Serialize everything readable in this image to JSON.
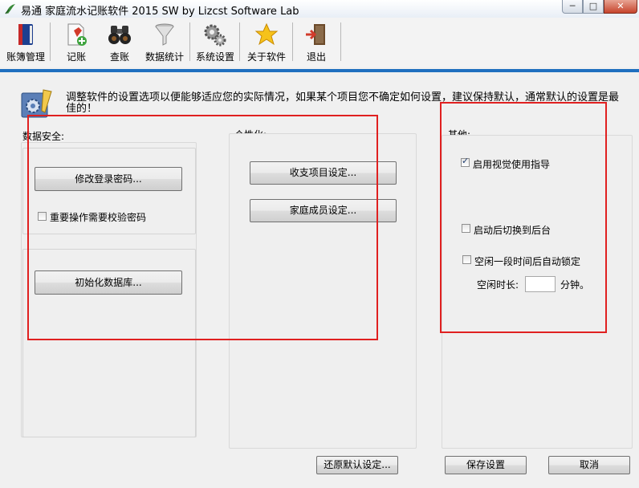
{
  "window": {
    "title": "易通 家庭流水记账软件 2015  SW   by Lizcst Software Lab",
    "controls": {
      "minimize": "─",
      "maximize": "□",
      "close": "✕"
    }
  },
  "toolbar": {
    "items": [
      {
        "label": "账簿管理",
        "icon": "ledger-book-icon"
      },
      {
        "label": "记账",
        "icon": "document-add-icon"
      },
      {
        "label": "查账",
        "icon": "binoculars-icon"
      },
      {
        "label": "数据统计",
        "icon": "funnel-icon"
      },
      {
        "label": "系统设置",
        "icon": "gears-icon"
      },
      {
        "label": "关于软件",
        "icon": "star-icon"
      },
      {
        "label": "退出",
        "icon": "exit-door-icon"
      }
    ]
  },
  "info": {
    "text": "调整软件的设置选项以便能够适应您的实际情况，如果某个项目您不确定如何设置，建议保持默认，通常默认的设置是最佳的！"
  },
  "security": {
    "title": "数据安全:",
    "change_password": "修改登录密码...",
    "verify_password_label": "重要操作需要校验密码",
    "verify_password_checked": false,
    "init_database": "初始化数据库..."
  },
  "personal": {
    "title": "个性化:",
    "income_expense_items": "收支项目设定...",
    "family_members": "家庭成员设定..."
  },
  "other": {
    "title": "其他:",
    "visual_guide_label": "启用视觉使用指导",
    "visual_guide_checked": true,
    "switch_background_label": "启动后切换到后台",
    "switch_background_checked": false,
    "auto_lock_label": "空闲一段时间后自动锁定",
    "auto_lock_checked": false,
    "idle_time_label": "空闲时长:",
    "idle_time_value": "",
    "idle_time_unit": "分钟。"
  },
  "footer": {
    "restore_defaults": "还原默认设定...",
    "save": "保存设置",
    "cancel": "取消"
  },
  "colors": {
    "accent_line": "#1f6fbf",
    "highlight_box": "#e02020"
  }
}
